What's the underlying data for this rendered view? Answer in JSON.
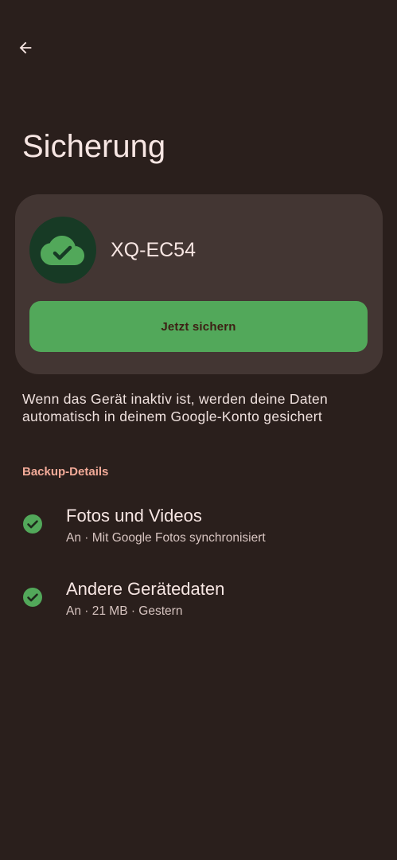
{
  "header": {
    "back_icon": "arrow-back-icon",
    "title": "Sicherung"
  },
  "device_card": {
    "icon": "cloud-check-icon",
    "device_name": "XQ-EC54",
    "backup_button_label": "Jetzt sichern"
  },
  "info_text": "Wenn das Gerät inaktiv ist, werden deine Daten automatisch in deinem Google-Konto gesichert",
  "backup_details": {
    "section_title": "Backup-Details",
    "items": [
      {
        "icon": "check-circle-icon",
        "title": "Fotos und Videos",
        "subtitle": "An · Mit Google Fotos synchronisiert"
      },
      {
        "icon": "check-circle-icon",
        "title": "Andere Gerätedaten",
        "subtitle": "An · 21 MB · Gestern"
      }
    ]
  },
  "colors": {
    "background": "#2a1f1c",
    "card": "#433633",
    "accent_green": "#52a85a",
    "section_header": "#f2aa98",
    "avatar_bg": "#173a25"
  }
}
